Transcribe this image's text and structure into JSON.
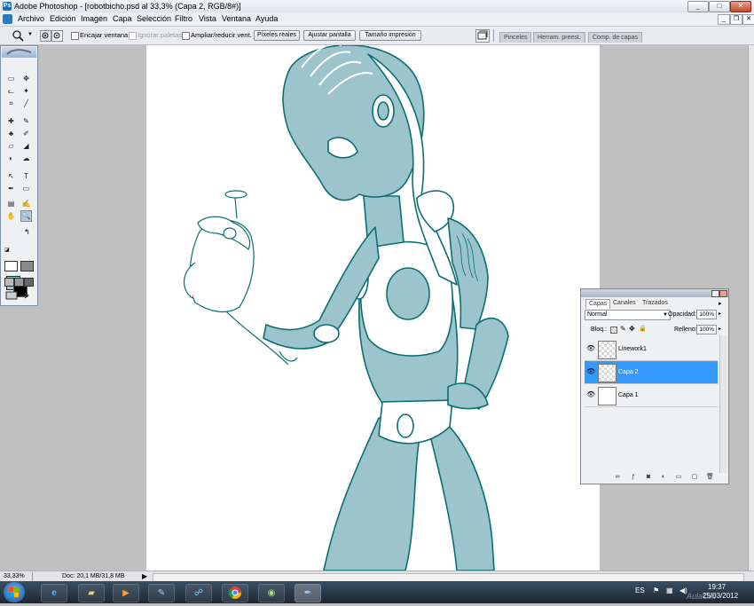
{
  "window": {
    "title": "Adobe Photoshop - [robotbicho.psd al 33,3% (Capa 2, RGB/8#)]",
    "controls": {
      "minimize": "_",
      "maximize": "□",
      "close": "✕"
    }
  },
  "menu": {
    "items": [
      "Archivo",
      "Edición",
      "Imagen",
      "Capa",
      "Selección",
      "Filtro",
      "Vista",
      "Ventana",
      "Ayuda"
    ],
    "doc_controls": {
      "minimize": "_",
      "restore": "❐",
      "close": "✕"
    }
  },
  "options": {
    "tool_icon": "zoom-icon",
    "encajar": "Encajar ventana",
    "ignorar": "Ignorar paletas",
    "ampliar": "Ampliar/reducir vent.",
    "btn_pixeles": "Píxeles reales",
    "btn_ajustar": "Ajustar pantalla",
    "btn_tamano": "Tamaño impresión",
    "workspace_tabs": [
      "Pinceles",
      "Herram. preest.",
      "Comp. de capas"
    ]
  },
  "toolbox": {
    "tools": [
      "▭",
      "✥",
      "ᓚ",
      "✦",
      "⌗",
      "╱",
      "✚",
      "✎",
      "♣",
      "✐",
      "▱",
      "◢",
      "◐",
      "☁",
      "↖",
      "T",
      "✒",
      "▭",
      "▤",
      "✍",
      "✋",
      "🔍"
    ],
    "foreground_color": "#9cc4cc",
    "background_color": "#000000"
  },
  "layers_panel": {
    "tabs": [
      "Capas",
      "Canales",
      "Trazados"
    ],
    "blend_mode": "Normal",
    "opacity_label": "Opacidad:",
    "opacity_value": "100%",
    "lock_label": "Bloq.:",
    "fill_label": "Relleno:",
    "fill_value": "100%",
    "layers": [
      {
        "name": "Linework1",
        "visible": true,
        "selected": false
      },
      {
        "name": "Capa 2",
        "visible": true,
        "selected": true
      },
      {
        "name": "Capa 1",
        "visible": true,
        "selected": false
      }
    ]
  },
  "statusbar": {
    "zoom": "33,33%",
    "doc": "Doc: 20,1 MB/31,8 MB"
  },
  "taskbar": {
    "apps": [
      "internet-explorer-icon",
      "folder-icon",
      "media-player-icon",
      "paint-icon",
      "network-icon",
      "chrome-icon",
      "image-viewer-icon",
      "photoshop-icon"
    ],
    "language": "ES",
    "time": "19:37",
    "date": "25/03/2012",
    "watermark": "AulaClic"
  },
  "colors": {
    "figure_fill": "#9cc4cc",
    "figure_line": "#0b6f72",
    "selection": "#3399ff"
  }
}
